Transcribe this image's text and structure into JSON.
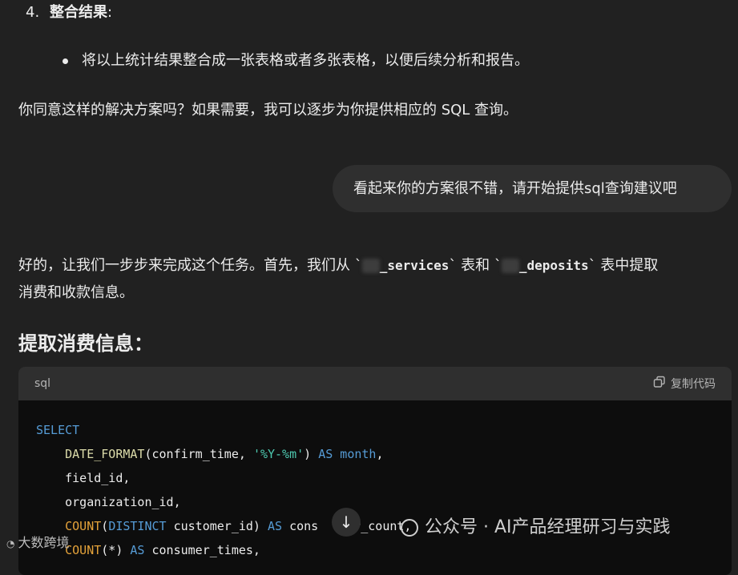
{
  "step4": {
    "number": "4.",
    "title": "整合结果",
    "colon": ":"
  },
  "bullet": {
    "text": "将以上统计结果整合成一张表格或者多张表格，以便后续分析和报告。"
  },
  "para1": "你同意这样的解决方案吗？如果需要，我可以逐步为你提供相应的 SQL 查询。",
  "user_message": "看起来你的方案很不错，请开始提供sql查询建议吧",
  "reply": {
    "seg1": "好的，让我们一步步来完成这个任务。首先，我们从 `",
    "code1": "_services",
    "seg2": "` 表和 `",
    "code2": "_deposits",
    "seg3": "` 表中提取",
    "line2": "消费和收款信息。"
  },
  "heading": "提取消费信息：",
  "code_block": {
    "language": "sql",
    "copy_label": "复制代码",
    "lines": {
      "l1_kw": "SELECT",
      "l2_fn": "DATE_FORMAT",
      "l2_a": "(confirm_time, ",
      "l2_str": "'%Y-%m'",
      "l2_b": ") ",
      "l2_as": "AS",
      "l2_month": " month",
      "l2_c": ",",
      "l3": "    field_id,",
      "l4": "    organization_id,",
      "l5_fn": "COUNT",
      "l5_a": "(",
      "l5_kw": "DISTINCT",
      "l5_b": " customer_id) ",
      "l5_as": "AS",
      "l5_c": " cons",
      "l5_d": "r_count,",
      "l6_fn": "COUNT",
      "l6_a": "(*) ",
      "l6_as": "AS",
      "l6_b": " consumer_times,"
    }
  },
  "scroll_icon": "arrow-down-icon",
  "watermark_right": "公众号 · AI产品经理研习与实践",
  "watermark_left": "大数跨境",
  "colors": {
    "bg": "#212121",
    "bubble": "#2f2f2f",
    "code_bg": "#0d0d0d",
    "keyword": "#569cd6",
    "string": "#4ec9b0",
    "function": "#e5a33a"
  }
}
